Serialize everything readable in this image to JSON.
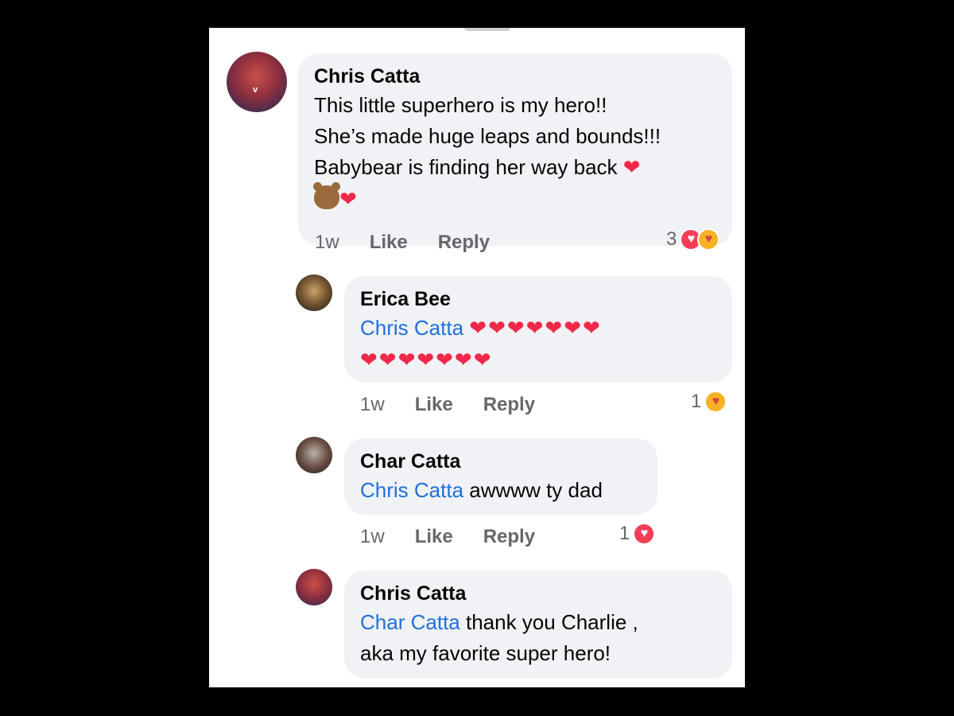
{
  "comments": [
    {
      "author": "Chris Catta",
      "lines": [
        "This little superhero is my hero!!",
        "She’s made huge leaps and bounds!!!",
        "Babybear is finding her way back"
      ],
      "time": "1w",
      "like": "Like",
      "reply": "Reply",
      "reaction_count": "3"
    },
    {
      "author": "Erica Bee",
      "mention": "Chris Catta",
      "time": "1w",
      "like": "Like",
      "reply": "Reply",
      "reaction_count": "1"
    },
    {
      "author": "Char Catta",
      "mention": "Chris Catta",
      "text": "awwww ty dad",
      "time": "1w",
      "like": "Like",
      "reply": "Reply",
      "reaction_count": "1"
    },
    {
      "author": "Chris Catta",
      "mention": "Char Catta",
      "text": "thank you Charlie ,",
      "text2": "aka my favorite super hero!"
    }
  ],
  "icons": {
    "heart": "red-heart-emoji",
    "bear": "bear-face-emoji",
    "love_reaction": "love-reaction-icon",
    "care_reaction": "care-reaction-icon"
  },
  "colors": {
    "mention": "#216fdb",
    "bubble": "#f0f2f5",
    "meta": "#65676b",
    "heart": "#f02849"
  }
}
